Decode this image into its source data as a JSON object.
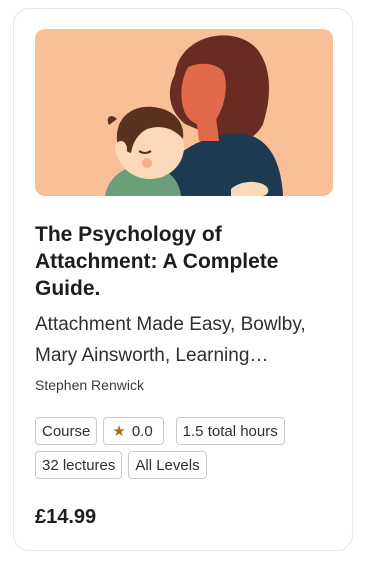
{
  "course": {
    "title": "The Psychology of Attachment: A Complete Guide.",
    "subtitle": "Attachment Made Easy, Bowlby, Mary Ainsworth, Learning…",
    "instructor": "Stephen Renwick",
    "price": "£14.99"
  },
  "badges": {
    "type": "Course",
    "rating": "0.0",
    "duration": "1.5 total hours",
    "lectures": "32 lectures",
    "level": "All Levels"
  },
  "thumbnail": {
    "icon": "mother-child-illustration",
    "background_color": "#f8bf98"
  },
  "colors": {
    "star": "#b4690e",
    "text": "#1c1d1f",
    "border": "#c9cacc"
  }
}
